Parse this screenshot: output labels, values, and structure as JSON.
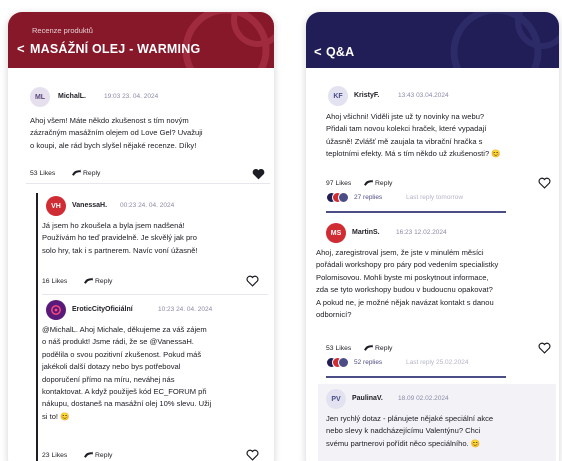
{
  "left_panel": {
    "breadcrumb": "Recenze produktů",
    "back_glyph": "<",
    "title": "MASÁŽNÍ OLEJ - WARMING",
    "reply_label": "Reply",
    "post": {
      "initials": "ML",
      "author": "MichalL.",
      "time": "19:03 23. 04. 2024",
      "lines": [
        "Ahoj všem! Máte někdo zkušenost s tím novým",
        "zázračným masážním olejem od Love Gel? Uvažuji",
        "o koupi, ale rád bych slyšel nějaké recenze. Díky!"
      ],
      "likes": "53 Likes",
      "liked": true
    },
    "replies": [
      {
        "initials": "VH",
        "author": "VanessaH.",
        "time": "00:23 24. 04. 2024",
        "lines": [
          "Já jsem ho zkoušela a byla jsem nadšená!",
          "Používám ho teď pravidelně. Je skvělý jak pro",
          "solo hry, tak i s partnerem. Navíc voní úžasně!"
        ],
        "likes": "16 Likes"
      },
      {
        "author": "EroticCityOficiální",
        "time": "10:23 24. 04. 2024",
        "lines": [
          "@MichalL. Ahoj Michale, děkujeme za váš zájem",
          "o náš produkt! Jsme rádi, že se @VanessaH.",
          "podělila o svou pozitivní zkušenost. Pokud máš",
          "jakékoli další dotazy nebo bys potřeboval",
          "doporučení přímo na míru, neváhej nás",
          "kontaktovat. A když použiješ kód EC_FORUM při",
          "nákupu, dostaneš na masážní olej 10% slevu. Užij",
          "si to! 😊"
        ],
        "likes": "23 Likes"
      }
    ]
  },
  "right_panel": {
    "back_glyph": "<",
    "title": "Q&A",
    "reply_label": "Reply",
    "threads": [
      {
        "initials": "KF",
        "author": "KristyF.",
        "time": "13:43 03.04.2024",
        "lines": [
          "Ahoj všichni! Viděli jste už ty novinky na webu?",
          "Přidali tam novou kolekci hraček, které vypadají",
          "úžasně! Zvlášť mě zaujala ta vibrační hračka s",
          "teplotními efekty. Má s tím někdo už zkušenosti? 😊"
        ],
        "likes": "97 Likes",
        "replies": "27 replies",
        "last_reply": "Last reply tomorrow"
      },
      {
        "initials": "MS",
        "author": "MartinS.",
        "time": "16:23 12.02.2024",
        "lines": [
          "Ahoj, zaregistroval jsem, že jste v minulém měsíci",
          "pořádali workshopy pro páry pod vedením specialistky",
          "Polomisovou. Mohli byste mi poskytnout informace,",
          "zda se tyto workshopy budou v budoucnu opakovat?",
          "A pokud ne, je možné nějak navázat kontakt s danou",
          "odbornicí?"
        ],
        "likes": "53 Likes",
        "replies": "52 replies",
        "last_reply": "Last reply 25.02.2024"
      },
      {
        "initials": "PV",
        "author": "PaulinaV.",
        "time": "18.09 02.02.2024",
        "lines": [
          "Jen rychlý dotaz - plánujete nějaké speciální akce",
          "nebo slevy k nadcházejícímu Valentýnu? Chci",
          "svému partnerovi pořídit něco speciálního. 😊"
        ]
      }
    ]
  },
  "colors": {
    "left_header": "#86182a",
    "right_header": "#201d57",
    "accent": "#4b4d86"
  },
  "icons": [
    "back-chevron-icon",
    "reply-arrow-icon",
    "heart-icon",
    "heart-filled-icon",
    "brand-logo-icon"
  ]
}
